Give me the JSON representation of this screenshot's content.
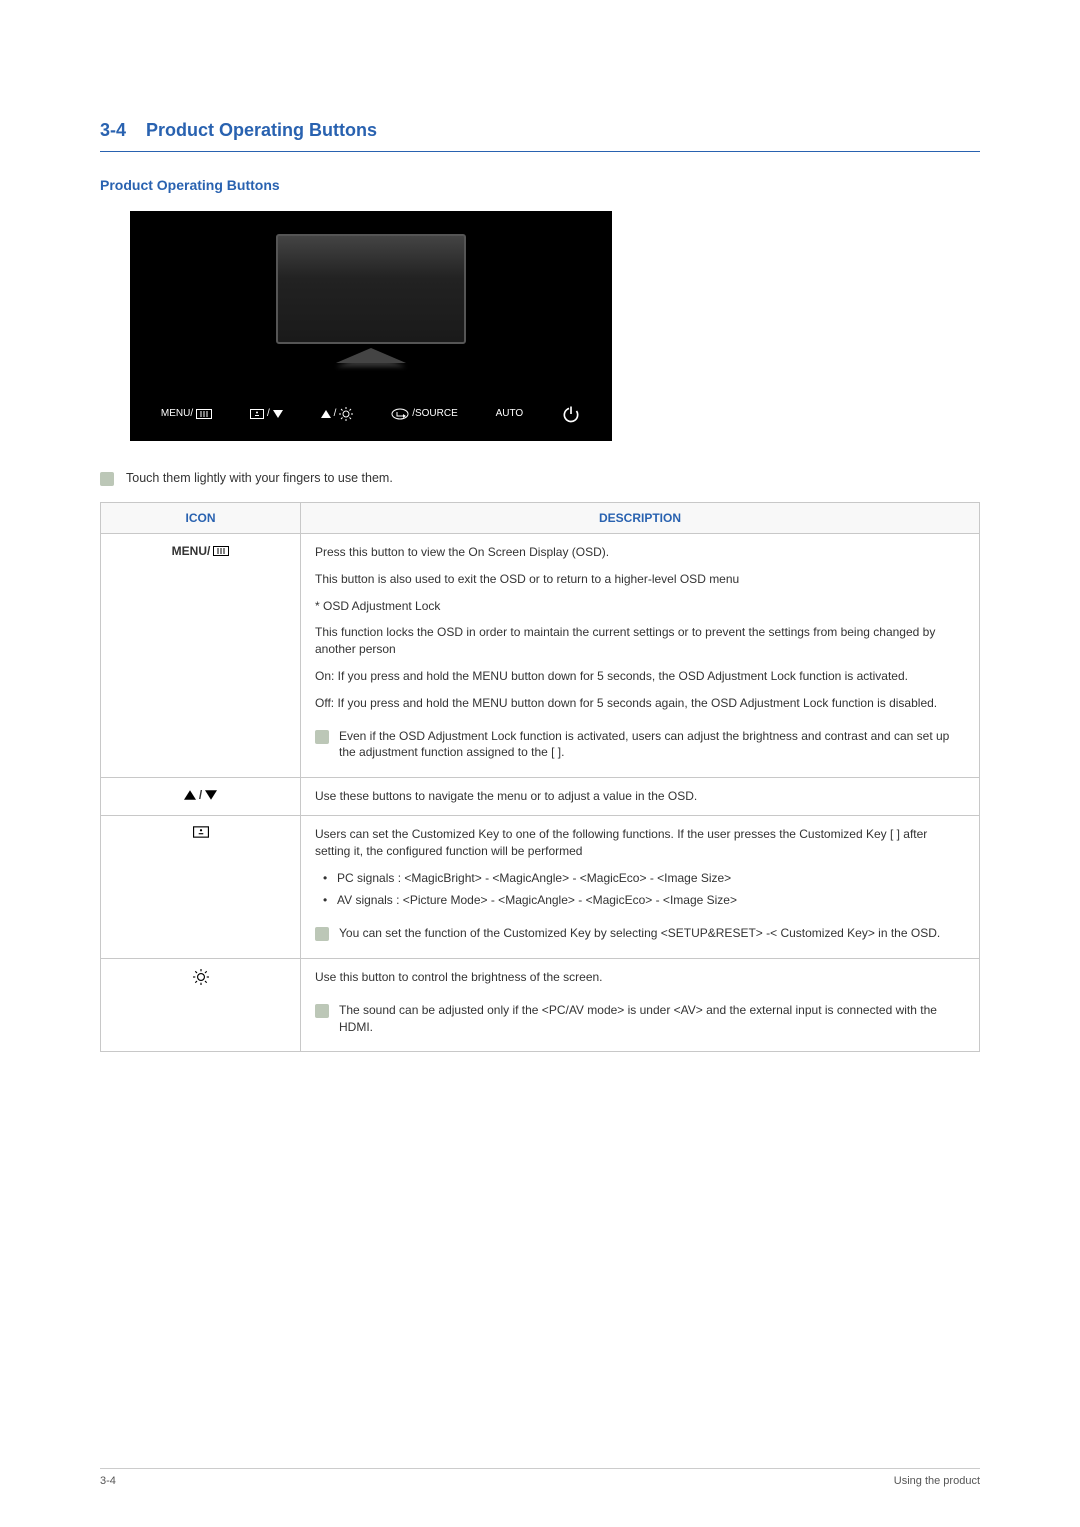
{
  "section": {
    "number": "3-4",
    "title": "Product Operating Buttons"
  },
  "subheader": "Product Operating Buttons",
  "strip": {
    "menu": "MENU/",
    "source": "/SOURCE",
    "auto": "AUTO"
  },
  "top_note": "Touch them lightly with your fingers to use them.",
  "table": {
    "col_icon": "ICON",
    "col_desc": "DESCRIPTION"
  },
  "rows": {
    "menu": {
      "icon_text": "MENU/",
      "p1": "Press this button to view the On Screen Display (OSD).",
      "p2": "This button is also used to exit the OSD or to return to a higher-level OSD menu",
      "p3": "* OSD Adjustment Lock",
      "p4": "This function locks the OSD in order to maintain the current settings or to prevent the settings from being changed by another person",
      "p5": "On: If you press and hold the MENU button down for 5 seconds, the OSD Adjustment Lock function is activated.",
      "p6": "Off: If you press and hold the MENU button down for 5 seconds again, the OSD Adjustment Lock function is disabled.",
      "note": "Even if the OSD Adjustment Lock function is activated, users can adjust the brightness and contrast and can set up the adjustment function assigned to the [    ]."
    },
    "nav": {
      "p1": "Use these buttons to navigate the menu or to adjust a value in the OSD."
    },
    "custom": {
      "p1": "Users can set the Customized Key to one of the following functions. If the user presses the Customized Key [    ] after setting it, the configured function will be performed",
      "li1": "PC signals : <MagicBright> - <MagicAngle> - <MagicEco> - <Image Size>",
      "li2": "AV signals : <Picture Mode> - <MagicAngle> - <MagicEco> - <Image Size>",
      "note": "You can set the function of the Customized Key by selecting <SETUP&RESET> -< Customized Key> in the OSD."
    },
    "bright": {
      "p1": "Use this button to control the brightness of the screen.",
      "note": "The sound can be adjusted only if the <PC/AV mode> is under <AV> and the external input is connected with the HDMI."
    }
  },
  "footer": {
    "left": "3-4",
    "right": "Using the product"
  }
}
